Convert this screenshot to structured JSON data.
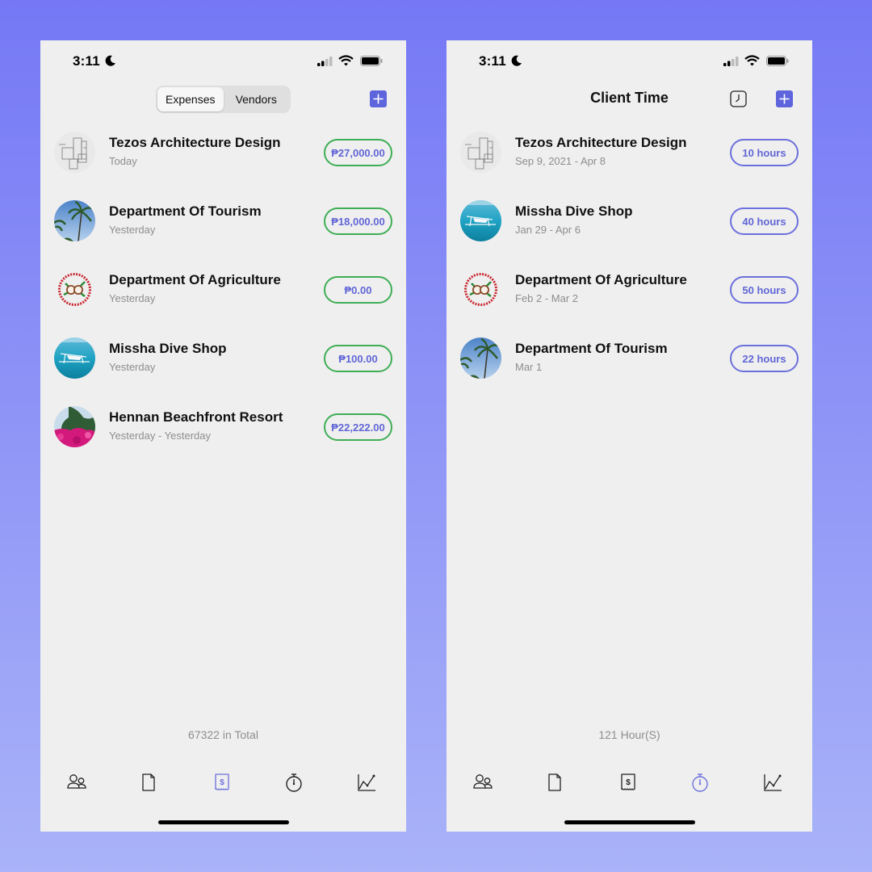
{
  "status_bar": {
    "time": "3:11"
  },
  "colors": {
    "accent": "#5E64DC",
    "pill_text": "#6166D6",
    "expense_border": "#3EAE55",
    "hours_border": "#6C70DC",
    "background_top": "#7578F5",
    "background_bottom": "#A9B3F8",
    "screen_bg": "#EFEFEF"
  },
  "expenses_screen": {
    "segments": [
      {
        "label": "Expenses",
        "selected": true
      },
      {
        "label": "Vendors",
        "selected": false
      }
    ],
    "add_icon": "plus-icon",
    "items": [
      {
        "name": "Tezos Architecture Design",
        "date": "Today",
        "amount": "₱27,000.00",
        "avatar": "floorplan"
      },
      {
        "name": "Department Of Tourism",
        "date": "Yesterday",
        "amount": "₱18,000.00",
        "avatar": "palm-sky"
      },
      {
        "name": "Department Of Agriculture",
        "date": "Yesterday",
        "amount": "₱0.00",
        "avatar": "coconut-logo"
      },
      {
        "name": "Missha Dive Shop",
        "date": "Yesterday",
        "amount": "₱100.00",
        "avatar": "boat-sea"
      },
      {
        "name": "Hennan Beachfront Resort",
        "date": "Yesterday - Yesterday",
        "amount": "₱22,222.00",
        "avatar": "flowers-trees"
      }
    ],
    "total": "67322 in Total",
    "active_tab": "expenses"
  },
  "time_screen": {
    "title": "Client Time",
    "clock_icon": "clock-icon",
    "add_icon": "plus-icon",
    "items": [
      {
        "name": "Tezos Architecture Design",
        "date": "Sep 9, 2021 - Apr 8",
        "hours": "10 hours",
        "avatar": "floorplan"
      },
      {
        "name": "Missha Dive Shop",
        "date": "Jan 29 - Apr 6",
        "hours": "40 hours",
        "avatar": "boat-sea"
      },
      {
        "name": "Department Of Agriculture",
        "date": "Feb 2 - Mar 2",
        "hours": "50 hours",
        "avatar": "coconut-logo"
      },
      {
        "name": "Department Of Tourism",
        "date": "Mar 1",
        "hours": "22 hours",
        "avatar": "palm-sky"
      }
    ],
    "total": "121 Hour(S)",
    "active_tab": "timer"
  },
  "tabbar": [
    {
      "id": "clients",
      "icon": "people-icon"
    },
    {
      "id": "invoices",
      "icon": "document-icon"
    },
    {
      "id": "expenses",
      "icon": "receipt-icon"
    },
    {
      "id": "timer",
      "icon": "stopwatch-icon"
    },
    {
      "id": "reports",
      "icon": "chart-icon"
    }
  ]
}
